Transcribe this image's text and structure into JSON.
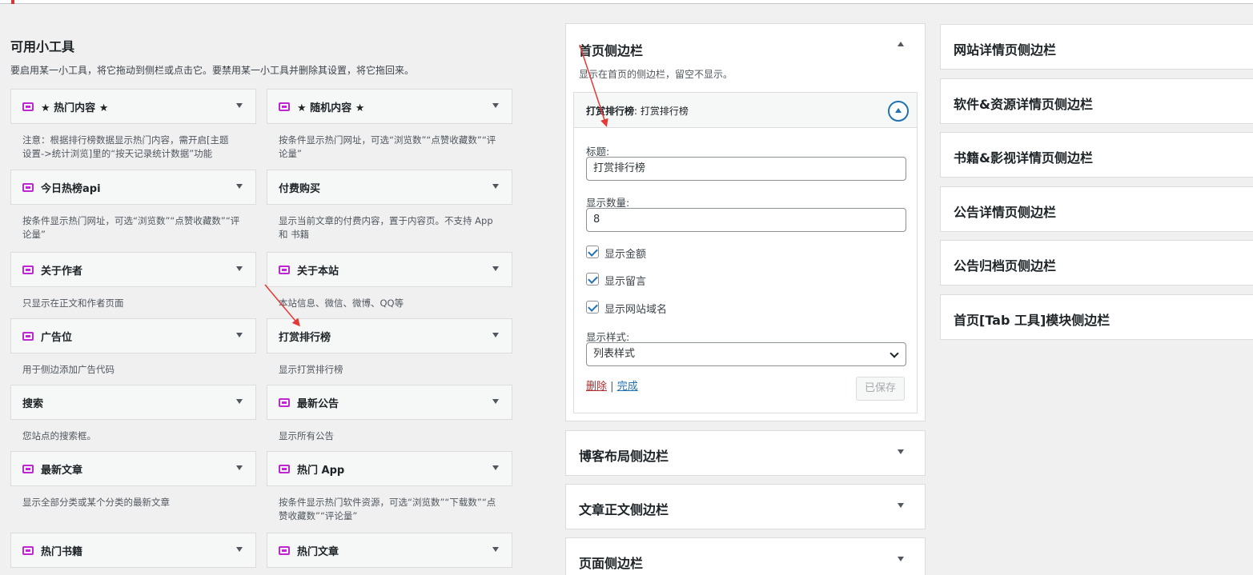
{
  "available": {
    "title": "可用小工具",
    "description": "要启用某一小工具，将它拖动到侧栏或点击它。要禁用某一小工具并删除其设置，将它拖回来。",
    "widgets": [
      {
        "name": "★ 热门内容 ★",
        "desc": [
          "注意：根据排行榜数据显示热门内容，需开启[主题",
          "设置->统计浏览]里的“按天记录统计数据”功能"
        ],
        "icon": "widget-icon"
      },
      {
        "name": "★ 随机内容 ★",
        "desc": [
          "按条件显示热门网址，可选“浏览数”“点赞收藏数”“评",
          "论量”"
        ],
        "icon": "widget-icon"
      },
      {
        "name": "今日热榜api",
        "desc": [
          "按条件显示热门网址，可选“浏览数”“点赞收藏数”“评",
          "论量”"
        ],
        "icon": "widget-icon"
      },
      {
        "name": "付费购买",
        "desc": [
          "显示当前文章的付费内容，置于内容页。不支持 App",
          "和 书籍"
        ],
        "icon": ""
      },
      {
        "name": "关于作者",
        "desc": [
          "只显示在正文和作者页面"
        ],
        "icon": "widget-icon"
      },
      {
        "name": "关于本站",
        "desc": [
          "本站信息、微信、微博、QQ等"
        ],
        "icon": "widget-icon"
      },
      {
        "name": "广告位",
        "desc": [
          "用于侧边添加广告代码"
        ],
        "icon": "widget-icon"
      },
      {
        "name": "打赏排行榜",
        "desc": [
          "显示打赏排行榜"
        ],
        "icon": ""
      },
      {
        "name": "搜索",
        "desc": [
          "您站点的搜索框。"
        ],
        "icon": ""
      },
      {
        "name": "最新公告",
        "desc": [
          "显示所有公告"
        ],
        "icon": "widget-icon"
      },
      {
        "name": "最新文章",
        "desc": [
          "显示全部分类或某个分类的最新文章"
        ],
        "icon": "widget-icon"
      },
      {
        "name": "热门 App",
        "desc": [
          "按条件显示热门软件资源，可选“浏览数”“下载数”“点",
          "赞收藏数”“评论量”"
        ],
        "icon": "widget-icon"
      },
      {
        "name": "热门书籍",
        "desc": [],
        "icon": "widget-icon"
      },
      {
        "name": "热门文章",
        "desc": [],
        "icon": "widget-icon"
      }
    ]
  },
  "home_sidebar": {
    "title": "首页侧边栏",
    "description": "显示在首页的侧边栏，留空不显示。",
    "widget": {
      "header_bold": "打赏排行榜",
      "header_rest": ": 打赏排行榜",
      "title_label": "标题:",
      "title_value": "打赏排行榜",
      "count_label": "显示数量:",
      "count_value": "8",
      "checkboxes": [
        "显示金额",
        "显示留言",
        "显示网站域名"
      ],
      "style_label": "显示样式:",
      "style_value": "列表样式",
      "delete_link": "删除",
      "separator": "|",
      "done_link": "完成",
      "saved_button": "已保存"
    }
  },
  "middle_sidebars": [
    "博客布局侧边栏",
    "文章正文侧边栏",
    "页面侧边栏"
  ],
  "right_sidebars": [
    "网站详情页侧边栏",
    "软件&资源详情页侧边栏",
    "书籍&影视详情页侧边栏",
    "公告详情页侧边栏",
    "公告归档页侧边栏",
    "首页[Tab 工具]模块侧边栏"
  ],
  "colors": {
    "widget_icon": "#c026d3",
    "arrow": "#e53935",
    "link": "#2271b1",
    "delete": "#b32d2e"
  }
}
